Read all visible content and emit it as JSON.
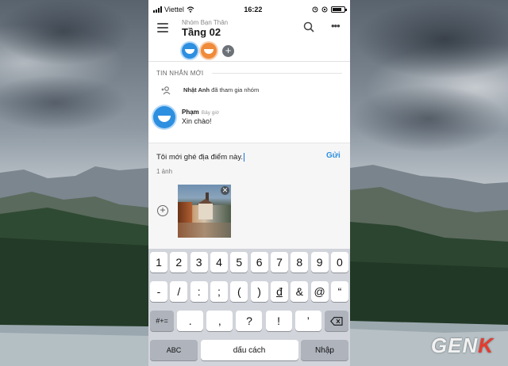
{
  "status_bar": {
    "carrier": "Viettel",
    "time": "16:22"
  },
  "header": {
    "subtitle": "Nhóm Bạn Thân",
    "title": "Tầng 02",
    "add_member_label": "+"
  },
  "feed": {
    "section_label": "TIN NHẮN MỚI",
    "join_event": {
      "name": "Nhật Anh",
      "text": "đã tham gia nhóm"
    },
    "message": {
      "sender": "Phạm",
      "time": "Bây giờ",
      "text": "Xin chào!"
    }
  },
  "compose": {
    "input_value": "Tôi mới ghé địa điểm này.",
    "send_label": "Gửi",
    "attachment_count": "1 ảnh",
    "add_attachment_label": "+",
    "remove_photo_label": "✕"
  },
  "keyboard": {
    "row1": [
      "1",
      "2",
      "3",
      "4",
      "5",
      "6",
      "7",
      "8",
      "9",
      "0"
    ],
    "row2": [
      "-",
      "/",
      ":",
      ";",
      "(",
      ")",
      "đ",
      "&",
      "@",
      "“"
    ],
    "row3_left": "#+=",
    "row3": [
      ".",
      ",",
      "?",
      "!",
      "’"
    ],
    "abc_label": "ABC",
    "space_label": "dấu cách",
    "enter_label": "Nhập",
    "backspace_icon": "backspace-icon"
  },
  "colors": {
    "accent_blue": "#2d8fe0",
    "avatar_orange": "#ef8b3a",
    "keyboard_bg": "#d1d4da"
  },
  "watermark": {
    "prefix": "GEN",
    "suffix": "K"
  }
}
